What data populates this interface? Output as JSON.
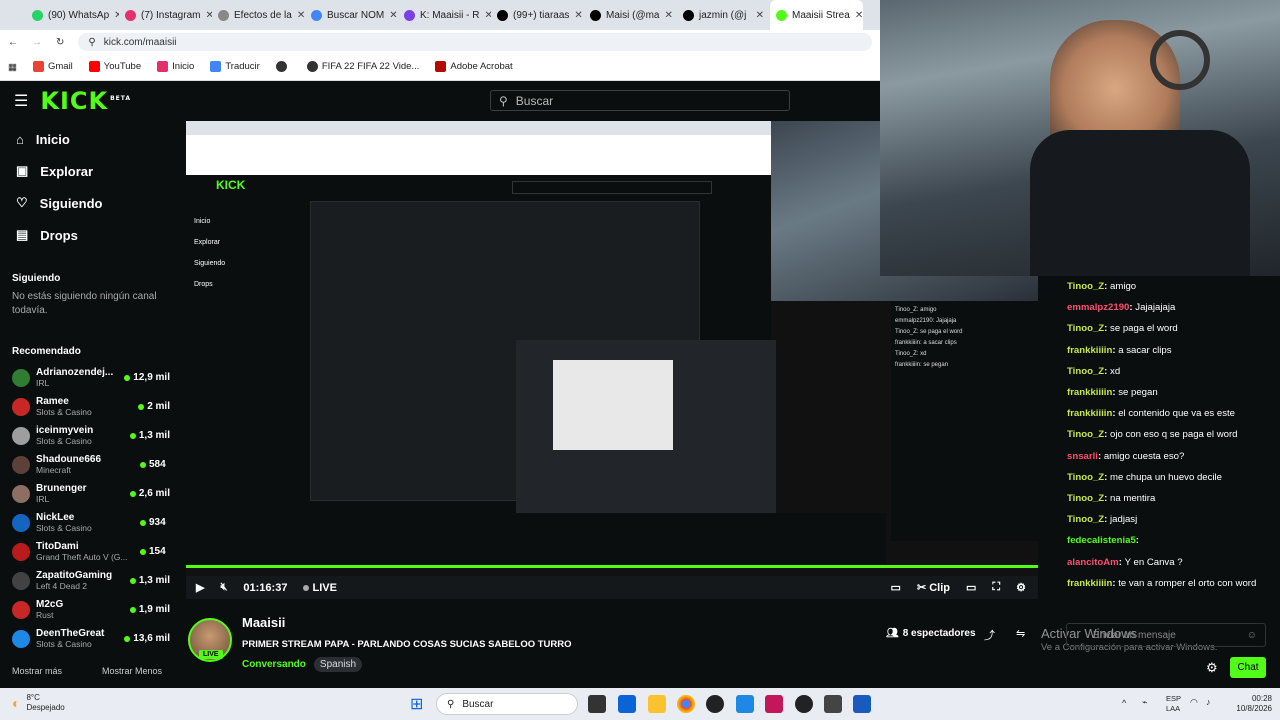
{
  "browser": {
    "tabs": [
      {
        "label": "(90) WhatsAp",
        "color": "#25d366"
      },
      {
        "label": "(7) Instagram",
        "color": "#e1306c"
      },
      {
        "label": "Efectos de la",
        "color": "#888"
      },
      {
        "label": "Buscar NOM",
        "color": "#4285f4"
      },
      {
        "label": "K: Maaisii - R",
        "color": "#7b3fe4"
      },
      {
        "label": "(99+) tiaraas",
        "color": "#000"
      },
      {
        "label": "Maisi (@ma",
        "color": "#000"
      },
      {
        "label": "jazmin (@j",
        "color": "#000"
      },
      {
        "label": "Maaisii Strea",
        "color": "#53fc18"
      }
    ],
    "url": "kick.com/maaisii",
    "bookmarks": [
      "Gmail",
      "YouTube",
      "Inicio",
      "Traducir",
      "",
      "FIFA 22 FIFA 22 Vide...",
      "Adobe Acrobat"
    ]
  },
  "header": {
    "logo": "KICK",
    "beta": "BETA",
    "search_placeholder": "Buscar"
  },
  "sidebar": {
    "nav": [
      {
        "label": "Inicio",
        "icon": "home-icon"
      },
      {
        "label": "Explorar",
        "icon": "explore-icon"
      },
      {
        "label": "Siguiendo",
        "icon": "heart-icon"
      },
      {
        "label": "Drops",
        "icon": "drops-icon"
      }
    ],
    "following_title": "Siguiendo",
    "following_empty": "No estás siguiendo ningún canal todavía.",
    "recommended_title": "Recomendado",
    "recommended": [
      {
        "name": "Adrianozendej...",
        "category": "IRL",
        "viewers": "12,9 mil",
        "color": "#2e7d32"
      },
      {
        "name": "Ramee",
        "category": "Slots & Casino",
        "viewers": "2 mil",
        "color": "#c62828"
      },
      {
        "name": "iceinmyvein",
        "category": "Slots & Casino",
        "viewers": "1,3 mil",
        "color": "#9e9e9e"
      },
      {
        "name": "Shadoune666",
        "category": "Minecraft",
        "viewers": "584",
        "color": "#5d4037"
      },
      {
        "name": "Brunenger",
        "category": "IRL",
        "viewers": "2,6 mil",
        "color": "#8d6e63"
      },
      {
        "name": "NickLee",
        "category": "Slots & Casino",
        "viewers": "934",
        "color": "#1565c0"
      },
      {
        "name": "TitoDami",
        "category": "Grand Theft Auto V (G...",
        "viewers": "154",
        "color": "#b71c1c"
      },
      {
        "name": "ZapatitoGaming",
        "category": "Left 4 Dead 2",
        "viewers": "1,3 mil",
        "color": "#424242"
      },
      {
        "name": "M2cG",
        "category": "Rust",
        "viewers": "1,9 mil",
        "color": "#c62828"
      },
      {
        "name": "DeenTheGreat",
        "category": "Slots & Casino",
        "viewers": "13,6 mil",
        "color": "#1e88e5"
      }
    ],
    "show_more": "Mostrar más",
    "show_less": "Mostrar Menos"
  },
  "player": {
    "time": "01:16:37",
    "live": "LIVE",
    "clip": "Clip"
  },
  "stream": {
    "channel": "Maaisii",
    "title": "PRIMER STREAM PAPA - PARLANDO COSAS SUCIAS SABELOO TURRO",
    "category": "Conversando",
    "language": "Spanish",
    "viewers": "8 espectadores",
    "live_badge": "LIVE"
  },
  "chat": {
    "messages": [
      {
        "user": "Tinoo_Z",
        "text": "amigo",
        "color": "#c7e84a"
      },
      {
        "user": "emmalpz2190",
        "text": "Jajajajaja",
        "color": "#ff4d6d"
      },
      {
        "user": "Tinoo_Z",
        "text": "se paga el word",
        "color": "#c7e84a"
      },
      {
        "user": "frankkiiiin",
        "text": "a sacar clips",
        "color": "#c7e84a"
      },
      {
        "user": "Tinoo_Z",
        "text": "xd",
        "color": "#c7e84a"
      },
      {
        "user": "frankkiiiin",
        "text": "se pegan",
        "color": "#c7e84a"
      },
      {
        "user": "frankkiiiin",
        "text": "el contenido que va es este",
        "color": "#c7e84a"
      },
      {
        "user": "Tinoo_Z",
        "text": "ojo con eso q se paga el word",
        "color": "#c7e84a"
      },
      {
        "user": "snsarli",
        "text": "amigo cuesta eso?",
        "color": "#ff4d6d"
      },
      {
        "user": "Tinoo_Z",
        "text": "me chupa un huevo decile",
        "color": "#c7e84a"
      },
      {
        "user": "Tinoo_Z",
        "text": "na mentira",
        "color": "#c7e84a"
      },
      {
        "user": "Tinoo_Z",
        "text": "jadjasj",
        "color": "#c7e84a"
      },
      {
        "user": "fedecalistenia5",
        "text": "",
        "color": "#53fc18"
      },
      {
        "user": "alancitoAm",
        "text": "Y en Canva ?",
        "color": "#ff4d6d"
      },
      {
        "user": "frankkiiiin",
        "text": "te van a romper el orto con word",
        "color": "#c7e84a"
      }
    ],
    "input_placeholder": "Enviar un mensaje",
    "send_label": "Chat"
  },
  "windows_watermark": {
    "line1": "Activar Windows",
    "line2": "Ve a Configuración para activar Windows."
  },
  "taskbar": {
    "weather_temp": "8°C",
    "weather_desc": "Despejado",
    "search": "Buscar",
    "lang": "ESP",
    "lang2": "LAA",
    "time": "00:28",
    "date": "10/8/2026"
  }
}
